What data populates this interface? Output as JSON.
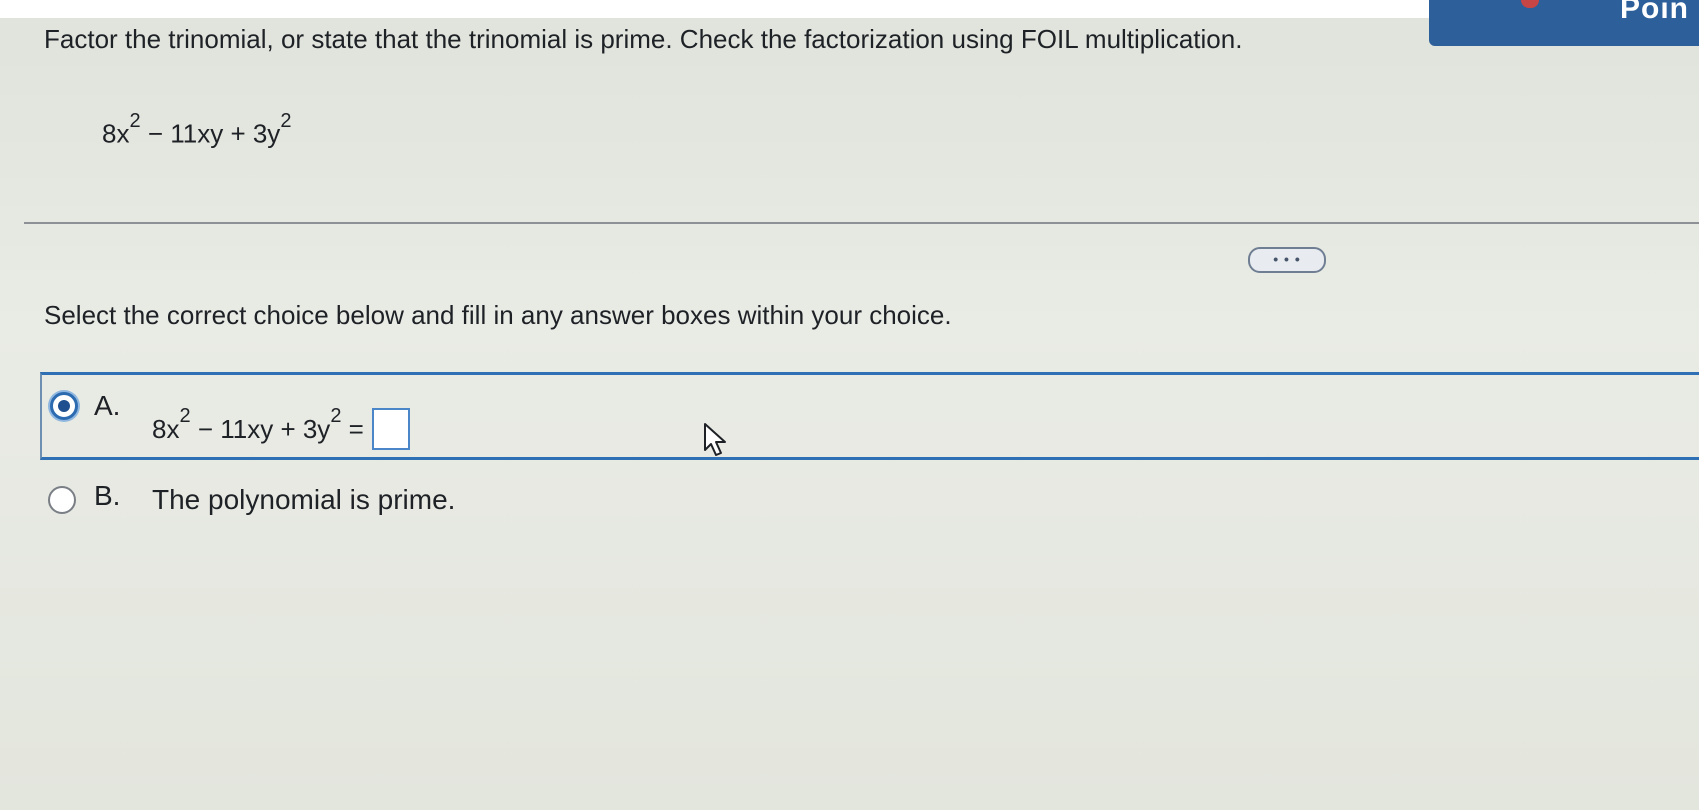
{
  "header": {
    "banner_text": "Poin"
  },
  "question": {
    "prompt": "Factor the trinomial, or state that the trinomial is prime. Check the factorization using FOIL multiplication.",
    "expression": {
      "t1": "8x",
      "e1": "2",
      "t2": " − 11xy + 3y",
      "e2": "2"
    }
  },
  "more_button": {
    "label": "• • •"
  },
  "instruction": "Select the correct choice below and fill in any answer boxes within your choice.",
  "choices": [
    {
      "letter": "A.",
      "selected": true,
      "expression": {
        "t1": "8x",
        "e1": "2",
        "t2": " − 11xy + 3y",
        "e2": "2",
        "eq": " ="
      },
      "answer_value": ""
    },
    {
      "letter": "B.",
      "selected": false,
      "text": "The polynomial is prime."
    }
  ],
  "colors": {
    "selection_blue": "#2f6fb3",
    "banner_blue": "#2d5f9a"
  },
  "icons": {
    "cursor": "mouse-pointer-icon"
  }
}
